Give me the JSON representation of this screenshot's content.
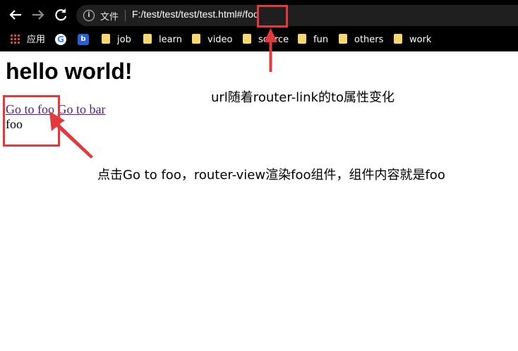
{
  "browser": {
    "address_bar": {
      "file_label": "文件",
      "url_prefix": "F:/test/test/test/test.html#",
      "url_hash": "/foo"
    },
    "bookmarks": [
      {
        "label": "应用",
        "icon": "apps-grid-icon"
      },
      {
        "label": "",
        "icon": "google-icon"
      },
      {
        "label": "",
        "icon": "baidu-icon"
      },
      {
        "label": "job",
        "icon": "folder-icon"
      },
      {
        "label": "learn",
        "icon": "folder-icon"
      },
      {
        "label": "video",
        "icon": "folder-icon"
      },
      {
        "label": "source",
        "icon": "folder-icon"
      },
      {
        "label": "fun",
        "icon": "folder-icon"
      },
      {
        "label": "others",
        "icon": "folder-icon"
      },
      {
        "label": "work",
        "icon": "folder-icon"
      }
    ]
  },
  "page": {
    "heading": "hello world!",
    "link_foo": "Go to foo",
    "link_bar": "Go to bar",
    "router_view": "foo"
  },
  "annotations": {
    "url_note": "url随着router-link的to属性变化",
    "click_note": "点击Go to foo，router-view渲染foo组件，组件内容就是foo"
  },
  "colors": {
    "annotation": "#e3393c",
    "link": "#551a8b"
  }
}
